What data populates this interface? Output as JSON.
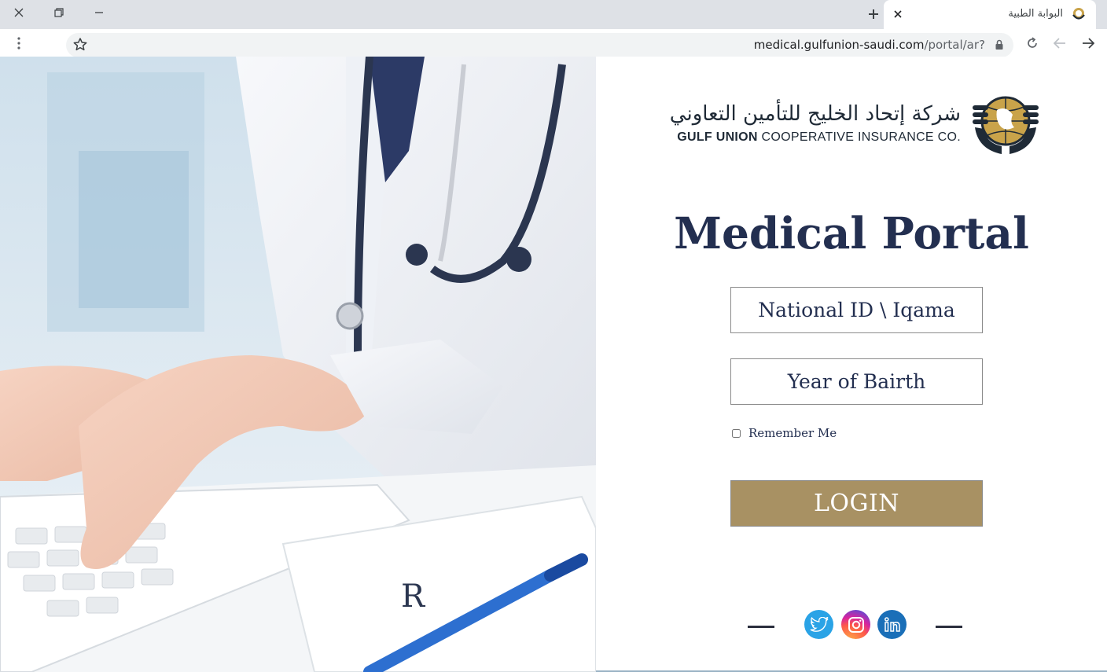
{
  "browser": {
    "tab_title": "البوابة الطبية",
    "url_host": "medical.gulfunion-saudi.com",
    "url_path": "/portal/ar?"
  },
  "logo": {
    "arabic_name": "شركة إتحاد الخليج للتأمين التعاوني",
    "english_bold": "GULF UNION",
    "english_rest": " COOPERATIVE INSURANCE CO."
  },
  "login": {
    "title": "Medical Portal",
    "national_id_placeholder": "National ID \\ Iqama",
    "birth_year_placeholder": "Year of Bairth",
    "remember_label": "Remember Me",
    "button_label": "LOGIN"
  },
  "social": [
    "twitter-icon",
    "instagram-icon",
    "linkedin-icon"
  ],
  "colors": {
    "title": "#232f50",
    "login_button": "#a89163",
    "twitter": "#2aa3e6",
    "linkedin": "#1a6fb8"
  }
}
